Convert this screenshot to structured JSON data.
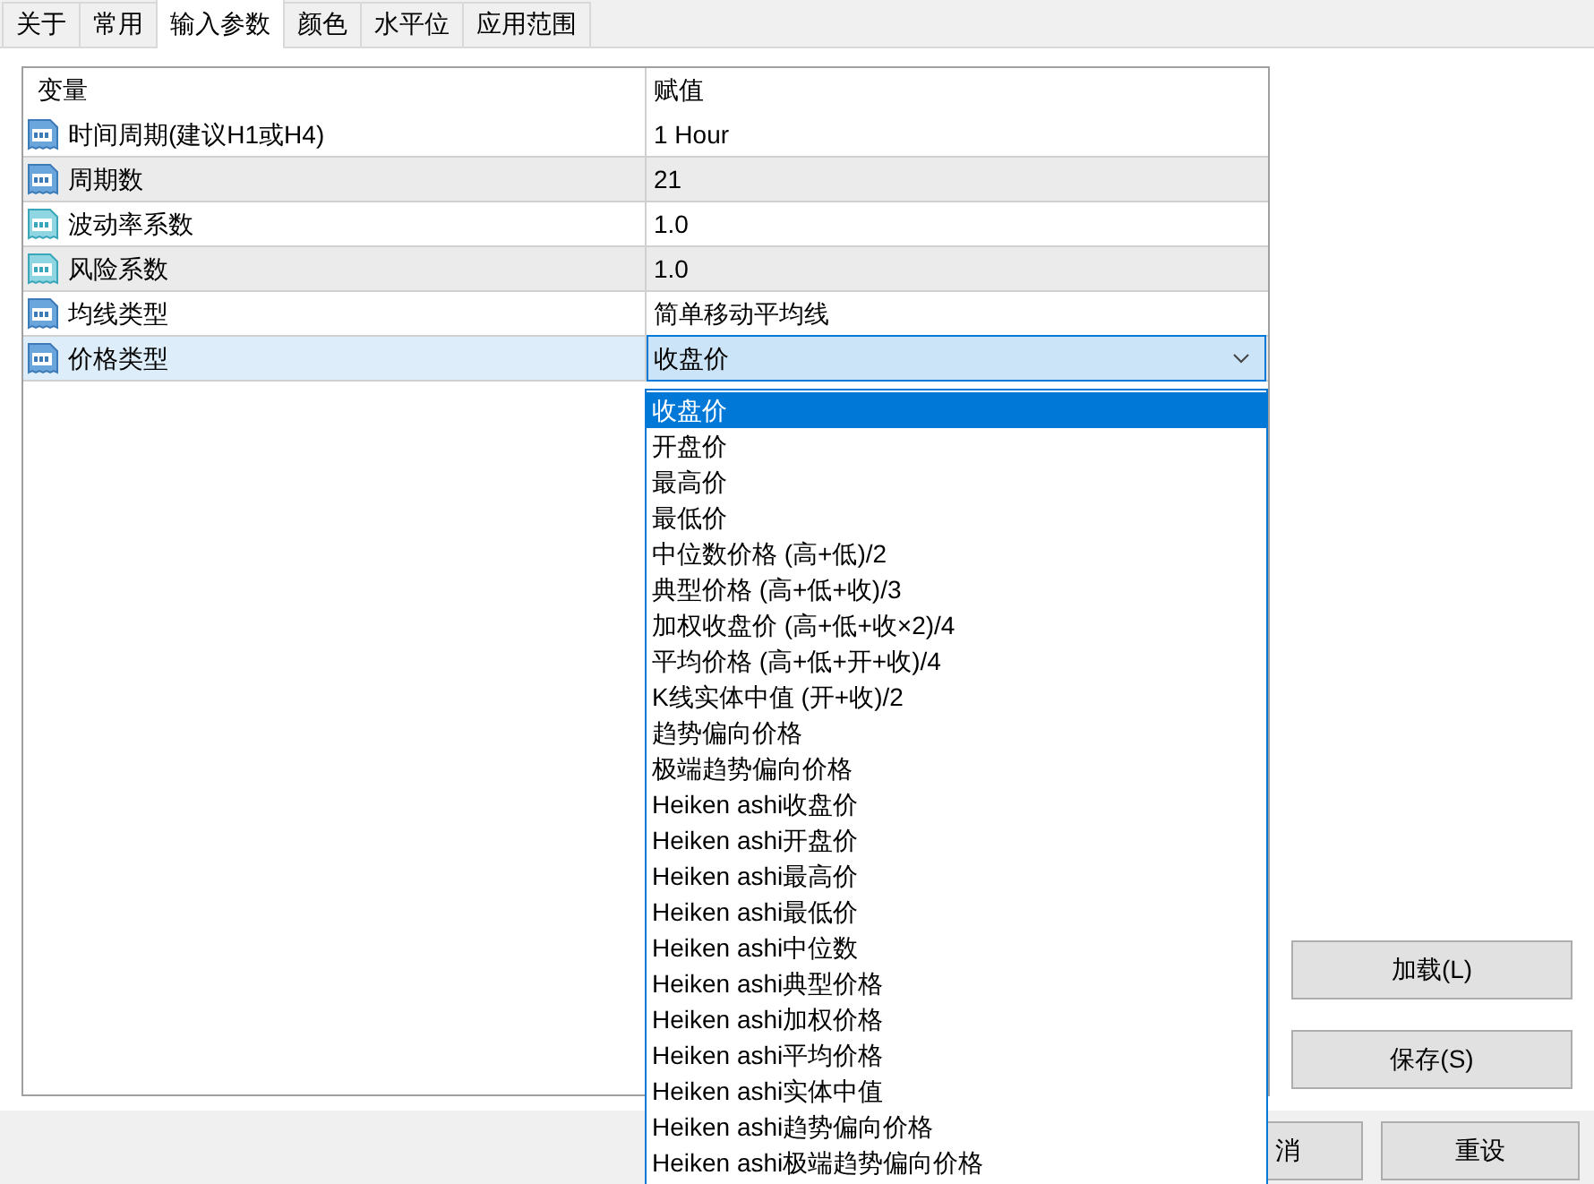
{
  "tabs": [
    {
      "label": "关于",
      "selected": false
    },
    {
      "label": "常用",
      "selected": false
    },
    {
      "label": "输入参数",
      "selected": true
    },
    {
      "label": "颜色",
      "selected": false
    },
    {
      "label": "水平位",
      "selected": false
    },
    {
      "label": "应用范围",
      "selected": false
    }
  ],
  "table": {
    "columns": [
      "变量",
      "赋值"
    ],
    "rows": [
      {
        "kind": "int",
        "name": "时间周期(建议H1或H4)",
        "value": "1 Hour",
        "selected": false
      },
      {
        "kind": "int",
        "name": "周期数",
        "value": "21",
        "selected": false
      },
      {
        "kind": "double",
        "name": "波动率系数",
        "value": "1.0",
        "selected": false
      },
      {
        "kind": "double",
        "name": "风险系数",
        "value": "1.0",
        "selected": false
      },
      {
        "kind": "int",
        "name": "均线类型",
        "value": "简单移动平均线",
        "selected": false
      },
      {
        "kind": "int",
        "name": "价格类型",
        "value": "收盘价",
        "selected": true,
        "expanded": true
      }
    ]
  },
  "dropdown": {
    "options": [
      {
        "label": "收盘价",
        "selected": true
      },
      {
        "label": "开盘价",
        "selected": false
      },
      {
        "label": "最高价",
        "selected": false
      },
      {
        "label": "最低价",
        "selected": false
      },
      {
        "label": "中位数价格 (高+低)/2",
        "selected": false
      },
      {
        "label": "典型价格 (高+低+收)/3",
        "selected": false
      },
      {
        "label": "加权收盘价 (高+低+收×2)/4",
        "selected": false
      },
      {
        "label": "平均价格 (高+低+开+收)/4",
        "selected": false
      },
      {
        "label": "K线实体中值 (开+收)/2",
        "selected": false
      },
      {
        "label": "趋势偏向价格",
        "selected": false
      },
      {
        "label": "极端趋势偏向价格",
        "selected": false
      },
      {
        "label": "Heiken ashi收盘价",
        "selected": false
      },
      {
        "label": "Heiken ashi开盘价",
        "selected": false
      },
      {
        "label": "Heiken ashi最高价",
        "selected": false
      },
      {
        "label": "Heiken ashi最低价",
        "selected": false
      },
      {
        "label": "Heiken ashi中位数",
        "selected": false
      },
      {
        "label": "Heiken ashi典型价格",
        "selected": false
      },
      {
        "label": "Heiken ashi加权价格",
        "selected": false
      },
      {
        "label": "Heiken ashi平均价格",
        "selected": false
      },
      {
        "label": "Heiken ashi实体中值",
        "selected": false
      },
      {
        "label": "Heiken ashi趋势偏向价格",
        "selected": false
      },
      {
        "label": "Heiken ashi极端趋势偏向价格",
        "selected": false
      }
    ]
  },
  "side_buttons": [
    "加载(L)",
    "保存(S)"
  ],
  "bottom_buttons": [
    "消",
    "重设"
  ]
}
